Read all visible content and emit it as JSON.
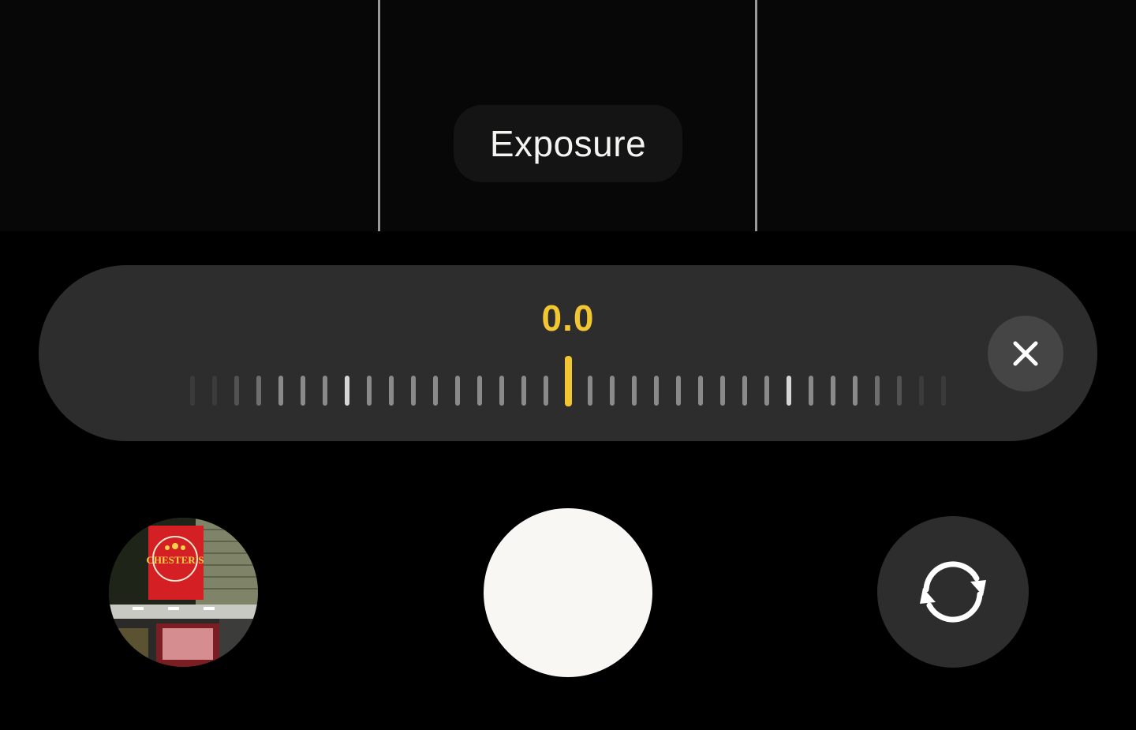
{
  "viewfinder": {
    "mode_label": "Exposure"
  },
  "exposure": {
    "value": "0.0",
    "value_color": "#f2c532",
    "tick_count": 35,
    "close_icon": "close-icon"
  },
  "controls": {
    "gallery_thumbnail_sign": "CHESTER'S",
    "shutter_icon": "shutter-button",
    "flip_icon": "flip-camera-icon"
  },
  "colors": {
    "background": "#000000",
    "panel": "#2d2d2d",
    "accent": "#f2c532",
    "shutter": "#f8f7f3"
  }
}
